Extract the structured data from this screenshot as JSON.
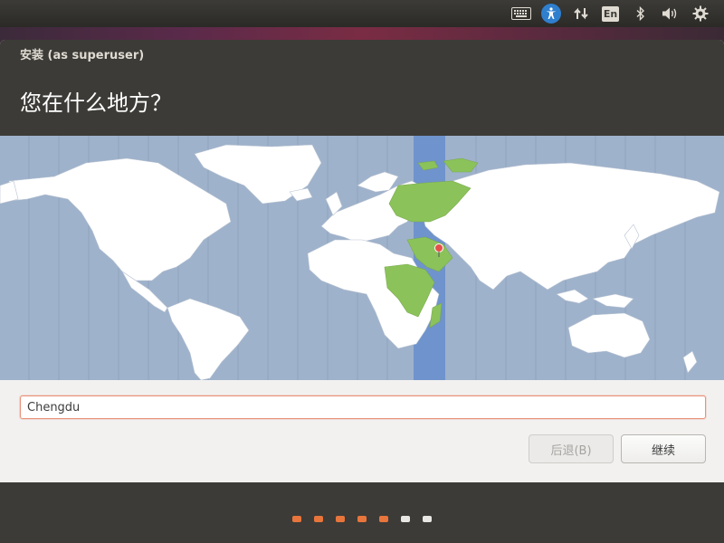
{
  "top_panel": {
    "indicators": [
      "keyboard-icon",
      "accessibility-icon",
      "network-icon",
      "language-indicator",
      "bluetooth-icon",
      "volume-icon",
      "settings-icon"
    ],
    "language_label": "En"
  },
  "window": {
    "title": "安装 (as superuser)",
    "heading": "您在什么地方？"
  },
  "map": {
    "ocean_color": "#9fb2cb",
    "land_color": "#ffffff",
    "highlight_color": "#8bc35a",
    "timezone_band_color": "#6f93cc",
    "marker_color": "#e6504a"
  },
  "location_input": {
    "value": "Chengdu"
  },
  "buttons": {
    "back_label": "后退(B)",
    "continue_label": "继续"
  },
  "progress": {
    "total_steps": 7,
    "completed_steps": 5,
    "active_color": "#e8753c",
    "inactive_color": "#e9e7e4"
  }
}
